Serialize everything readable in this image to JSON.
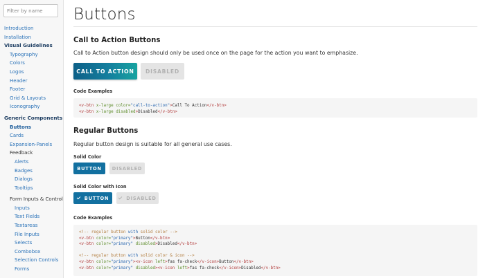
{
  "sidebar": {
    "filter_placeholder": "Filter by name",
    "items": [
      {
        "label": "Introduction"
      },
      {
        "label": "Installation"
      },
      {
        "label": "Visual Guidelines"
      },
      {
        "label": "Typography"
      },
      {
        "label": "Colors"
      },
      {
        "label": "Logos"
      },
      {
        "label": "Header"
      },
      {
        "label": "Footer"
      },
      {
        "label": "Grid & Layouts"
      },
      {
        "label": "Iconography"
      },
      {
        "label": "Generic Components"
      },
      {
        "label": "Buttons"
      },
      {
        "label": "Cards"
      },
      {
        "label": "Expansion-Panels"
      },
      {
        "label": "Feedback"
      },
      {
        "label": "Alerts"
      },
      {
        "label": "Badges"
      },
      {
        "label": "Dialogs"
      },
      {
        "label": "Tooltips"
      },
      {
        "label": "Form Inputs & Controls"
      },
      {
        "label": "Inputs"
      },
      {
        "label": "Text Fields"
      },
      {
        "label": "Textareas"
      },
      {
        "label": "File Inputs"
      },
      {
        "label": "Selects"
      },
      {
        "label": "Combobox"
      },
      {
        "label": "Selection Controls"
      },
      {
        "label": "Forms"
      }
    ]
  },
  "main": {
    "title": "Buttons",
    "cta_section": {
      "heading": "Call to Action Buttons",
      "description": "Call to Action button design should only be used once on the page for the action you want to emphasize.",
      "cta_button": "CALL TO ACTION",
      "disabled_button": "DISABLED",
      "code_label": "Code Examples"
    },
    "regular_section": {
      "heading": "Regular Buttons",
      "description": "Regular button design is suitable for all general use cases.",
      "solid_label": "Solid Color",
      "solid_button": "BUTTON",
      "solid_disabled": "DISABLED",
      "icon_label": "Solid Color with Icon",
      "icon_button": "BUTTON",
      "icon_disabled": "DISABLED",
      "code_label": "Code Examples"
    }
  },
  "code": {
    "cta1": {
      "tag": "v-btn",
      "a1": "x-large",
      "a2": "color=",
      "s": "\"call-to-action\"",
      "text": "Call To Action",
      "close": "</v-btn>"
    },
    "cta2": {
      "tag": "v-btn",
      "a1": "x-large",
      "a2": "disabled",
      "text": "Disabled",
      "close": "</v-btn>"
    },
    "reg": {
      "c1": "<!-- regular button ",
      "c1kw": "with",
      "c1b": " solid color -->",
      "l1tag": "v-btn",
      "l1attr": "color=",
      "l1str": "\"primary\"",
      "l1text": "Button",
      "l2tag": "v-btn",
      "l2attr": "color=",
      "l2str": "\"primary\"",
      "l2attr2": "disabled",
      "l2text": "Disabled",
      "c2": "<!-- regular button ",
      "c2kw": "with",
      "c2b": " solid color & icon -->",
      "l3tag": "v-btn",
      "l3attr": "color=",
      "l3str": "\"primary\"",
      "l3icon": "v-icon",
      "l3left": "left",
      "l3cls": "fas fa-check",
      "l3text": "Button",
      "l4tag": "v-btn",
      "l4attr": "color=",
      "l4str": "\"primary\"",
      "l4attr2": "disabled",
      "l4icon": "v-icon",
      "l4left": "left",
      "l4cls": "fas fa-check",
      "l4text": "Disabled"
    }
  },
  "colors": {
    "primary": "#1270a0",
    "link": "#2a72b8",
    "cta_gradient_start": "#0d6088",
    "cta_gradient_end": "#17a3a0"
  }
}
